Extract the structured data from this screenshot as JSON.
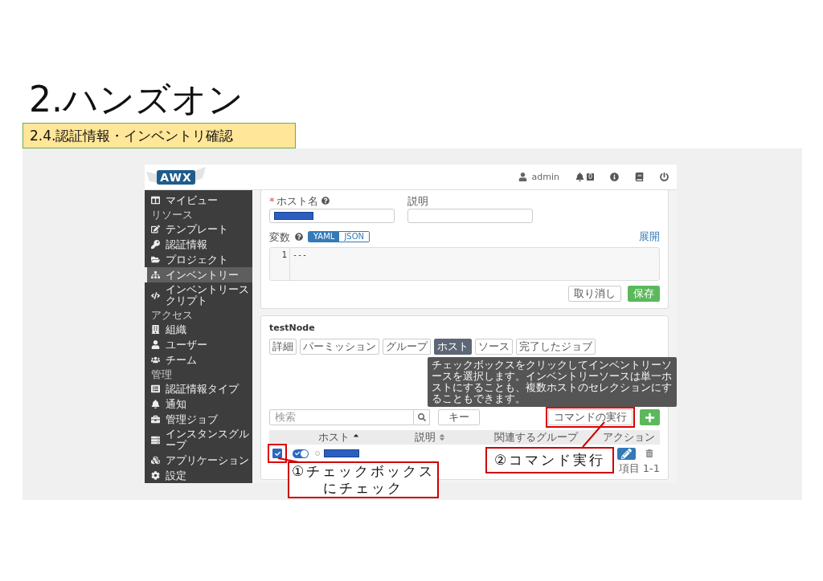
{
  "slide": {
    "title": "2.ハンズオン",
    "subtitle": "2.4.認証情報・インベントリ確認"
  },
  "app": {
    "logo": "AWX",
    "header": {
      "user": "admin",
      "notifications": "0"
    },
    "sidebar": [
      {
        "kind": "item",
        "label": "マイビュー",
        "selected": false
      },
      {
        "kind": "section",
        "label": "リソース"
      },
      {
        "kind": "item",
        "label": "テンプレート",
        "selected": false
      },
      {
        "kind": "item",
        "label": "認証情報",
        "selected": false
      },
      {
        "kind": "item",
        "label": "プロジェクト",
        "selected": false
      },
      {
        "kind": "item",
        "label": "インベントリー",
        "selected": true
      },
      {
        "kind": "item",
        "label": "インベントリースクリプト",
        "selected": false
      },
      {
        "kind": "section",
        "label": "アクセス"
      },
      {
        "kind": "item",
        "label": "組織",
        "selected": false
      },
      {
        "kind": "item",
        "label": "ユーザー",
        "selected": false
      },
      {
        "kind": "item",
        "label": "チーム",
        "selected": false
      },
      {
        "kind": "section",
        "label": "管理"
      },
      {
        "kind": "item",
        "label": "認証情報タイプ",
        "selected": false
      },
      {
        "kind": "item",
        "label": "通知",
        "selected": false
      },
      {
        "kind": "item",
        "label": "管理ジョブ",
        "selected": false
      },
      {
        "kind": "item",
        "label": "インスタンスグループ",
        "selected": false
      },
      {
        "kind": "item",
        "label": "アプリケーション",
        "selected": false
      },
      {
        "kind": "item",
        "label": "設定",
        "selected": false
      }
    ],
    "host_form": {
      "required_mark": "*",
      "hostname_label": "ホスト名",
      "description_label": "説明",
      "variables_label": "変数",
      "formats": [
        {
          "label": "YAML",
          "selected": true
        },
        {
          "label": "JSON",
          "selected": false
        }
      ],
      "expand_link": "展開",
      "editor_lines": [
        {
          "number": "1",
          "text": "---"
        }
      ],
      "buttons": [
        {
          "label": "取り消し",
          "kind": "default"
        },
        {
          "label": "保存",
          "kind": "success"
        }
      ]
    },
    "inventory": {
      "title": "testNode",
      "tabs": [
        {
          "label": "詳細",
          "selected": false
        },
        {
          "label": "パーミッション",
          "selected": false
        },
        {
          "label": "グループ",
          "selected": false
        },
        {
          "label": "ホスト",
          "selected": true
        },
        {
          "label": "ソース",
          "selected": false
        },
        {
          "label": "完了したジョブ",
          "selected": false
        }
      ],
      "search": {
        "placeholder": "検索"
      },
      "key_button": "キー",
      "run_command_button": "コマンドの実行",
      "tooltip": "チェックボックスをクリックしてインベントリーソースを選択します。インベントリーソースは単一ホストにすることも、複数ホストのセレクションにすることもできます。",
      "columns": [
        {
          "label": "ホスト",
          "sortable": true,
          "sorted": true
        },
        {
          "label": "説明",
          "sortable": true,
          "sorted": false
        },
        {
          "label": "関連するグループ"
        },
        {
          "label": "アクション"
        }
      ],
      "rows": [
        {
          "checked": true,
          "enabled": true
        }
      ],
      "pagination": "項目 1-1"
    }
  },
  "annotations": [
    {
      "text": "①チェックボックスにチェック"
    },
    {
      "text": "②コマンド実行"
    }
  ]
}
